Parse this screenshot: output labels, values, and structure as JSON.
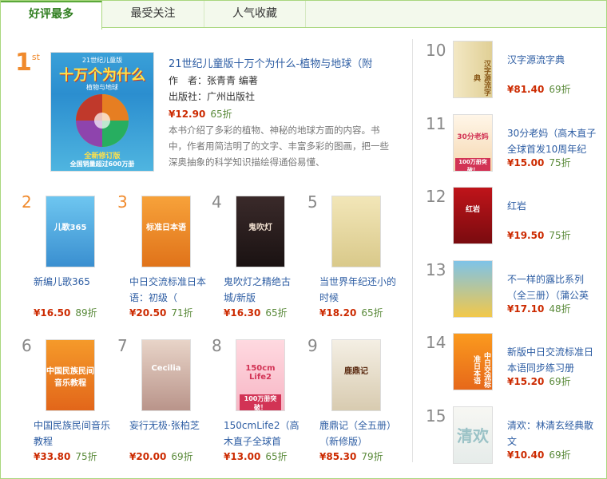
{
  "tabs": [
    {
      "label": "好评最多"
    },
    {
      "label": "最受关注"
    },
    {
      "label": "人气收藏"
    }
  ],
  "featured": {
    "rank": "1",
    "rank_suffix": "st",
    "title": "21世纪儿童版十万个为什么-植物与地球（附",
    "author_label": "作　者：",
    "author": "张青青 编著",
    "publisher_label": "出版社：",
    "publisher": "广州出版社",
    "price": "¥12.90",
    "discount": "65折",
    "description": "本书介绍了多彩的植物、神秘的地球方面的内容。书中，作者用简洁明了的文字、丰富多彩的图画，把一些深奥抽象的科学知识描绘得通俗易懂、",
    "cover_text": {
      "top": "21世纪儿童版",
      "title": "十万个为什么",
      "sub": "植物与地球",
      "badge1": "全新修订版",
      "badge2": "全国销量超过600万册"
    }
  },
  "grid": [
    {
      "rank": "2",
      "title": "新编儿歌365",
      "price": "¥16.50",
      "discount": "89折",
      "cover_text": "儿歌365"
    },
    {
      "rank": "3",
      "title": "中日交流标准日本语：初级（",
      "price": "¥20.50",
      "discount": "71折",
      "cover_text": "标准日本语"
    },
    {
      "rank": "4",
      "title": "鬼吹灯之精绝古城/新版",
      "price": "¥16.30",
      "discount": "65折",
      "cover_text": "鬼吹灯"
    },
    {
      "rank": "5",
      "title": "当世界年纪还小的时候",
      "price": "¥18.20",
      "discount": "65折",
      "cover_text": ""
    },
    {
      "rank": "6",
      "title": "中国民族民间音乐教程",
      "price": "¥33.80",
      "discount": "75折",
      "cover_text": "中国民族民间音乐教程"
    },
    {
      "rank": "7",
      "title": "妄行无极·张柏芝",
      "price": "¥20.00",
      "discount": "69折",
      "cover_text": "Cecilia"
    },
    {
      "rank": "8",
      "title": "150cmLife2（高木直子全球首",
      "price": "¥13.00",
      "discount": "65折",
      "cover_text": "150cm Life2",
      "cover_badge": "100万册突破！"
    },
    {
      "rank": "9",
      "title": "鹿鼎记（全五册）（新修版）",
      "price": "¥85.30",
      "discount": "79折",
      "cover_text": "鹿鼎记"
    }
  ],
  "side": [
    {
      "rank": "10",
      "title": "汉字源流字典",
      "price": "¥81.40",
      "discount": "69折",
      "cover_text": "汉字源流字典"
    },
    {
      "rank": "11",
      "title": "30分老妈（高木直子全球首发10周年纪",
      "price": "¥15.00",
      "discount": "75折",
      "cover_text": "30分老妈",
      "cover_badge": "100万册突破！"
    },
    {
      "rank": "12",
      "title": "红岩",
      "price": "¥19.50",
      "discount": "75折",
      "cover_text": "红岩"
    },
    {
      "rank": "13",
      "title": "不一样的露比系列（全三册）（蒲公英",
      "price": "¥17.10",
      "discount": "48折",
      "cover_text": ""
    },
    {
      "rank": "14",
      "title": "新版中日交流标准日本语同步练习册",
      "price": "¥15.20",
      "discount": "69折",
      "cover_text": "中日交流标准日本语"
    },
    {
      "rank": "15",
      "title": "清欢：林清玄经典散文",
      "price": "¥10.40",
      "discount": "69折",
      "cover_text": "清欢"
    }
  ],
  "colors": {
    "accent": "#5aa83a",
    "price": "#cc2a00",
    "link": "#2d5da3",
    "rank_hot": "#f08a2c"
  }
}
